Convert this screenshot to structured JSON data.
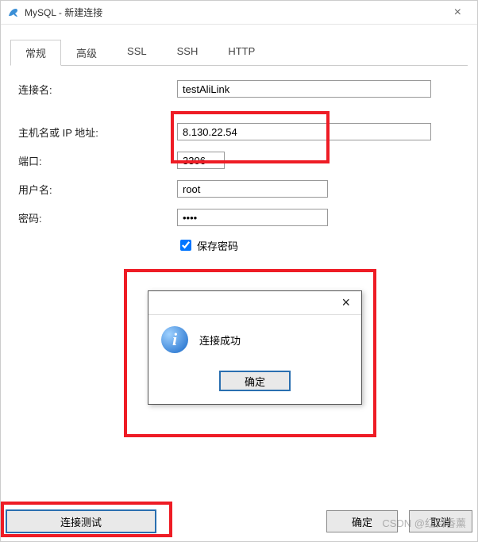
{
  "title": "MySQL - 新建连接",
  "tabs": {
    "general": "常规",
    "advanced": "高级",
    "ssl": "SSL",
    "ssh": "SSH",
    "http": "HTTP"
  },
  "labels": {
    "conn_name": "连接名:",
    "host": "主机名或 IP 地址:",
    "port": "端口:",
    "user": "用户名:",
    "pass": "密码:",
    "save_pass": "保存密码"
  },
  "values": {
    "conn_name": "testAliLink",
    "host": "8.130.22.54",
    "port": "3306",
    "user": "root",
    "pass": "••••"
  },
  "buttons": {
    "test": "连接测试",
    "ok": "确定",
    "cancel": "取消"
  },
  "modal": {
    "message": "连接成功",
    "ok": "确定"
  },
  "watermark": "CSDN @红目香薰"
}
